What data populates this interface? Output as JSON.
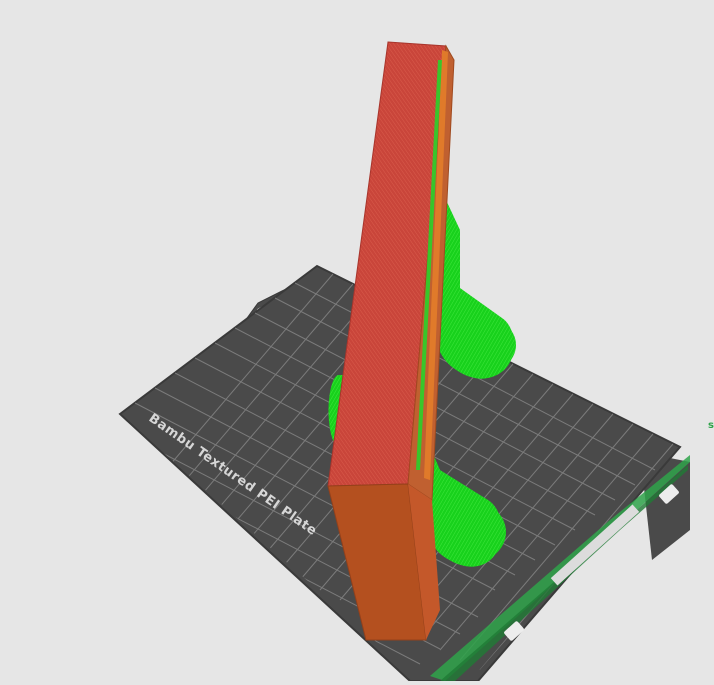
{
  "viewport": {
    "plate_label": "Bambu Textured PEI Plate",
    "colors": {
      "background": "#e6e6e6",
      "plate": "#4a4a4a",
      "plate_grid": "#8c8c8c",
      "plate_border": "#3a3a3a",
      "model_face": "#c9453a",
      "model_side": "#b9502a",
      "model_end": "#b4501f",
      "support": "#18d11c",
      "wipe_tower": "#2fa34a"
    }
  }
}
